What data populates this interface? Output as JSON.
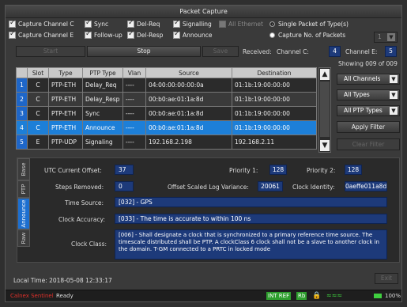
{
  "window": {
    "title": "Packet Capture"
  },
  "options": {
    "row1": [
      {
        "label": "Capture Channel C",
        "checked": true
      },
      {
        "label": "Sync",
        "checked": true
      },
      {
        "label": "Del-Req",
        "checked": true
      },
      {
        "label": "Signalling",
        "checked": true
      },
      {
        "label": "All Ethernet",
        "checked": false
      }
    ],
    "row2": [
      {
        "label": "Capture Channel E",
        "checked": true
      },
      {
        "label": "Follow-up",
        "checked": true
      },
      {
        "label": "Del-Resp",
        "checked": true
      },
      {
        "label": "Announce",
        "checked": true
      }
    ],
    "radio_single": "Single Packet of Type(s)",
    "radio_count": "Capture No. of Packets",
    "packet_count": "1"
  },
  "controls": {
    "start": "Start",
    "stop": "Stop",
    "save": "Save",
    "received_label": "Received:",
    "channel_c_label": "Channel C:",
    "channel_c_value": "4",
    "channel_e_label": "Channel E:",
    "channel_e_value": "5"
  },
  "table": {
    "headers": [
      "Slot",
      "Type",
      "PTP Type",
      "Vlan",
      "Source",
      "Destination"
    ],
    "rows": [
      {
        "idx": "1",
        "slot": "C",
        "type": "PTP-ETH",
        "ptp": "Delay_Req",
        "vlan": "----",
        "src": "04:00:00:00:00:0a",
        "dst": "01:1b:19:00:00:00"
      },
      {
        "idx": "2",
        "slot": "C",
        "type": "PTP-ETH",
        "ptp": "Delay_Resp",
        "vlan": "----",
        "src": "00:b0:ae:01:1a:8d",
        "dst": "01:1b:19:00:00:00"
      },
      {
        "idx": "3",
        "slot": "C",
        "type": "PTP-ETH",
        "ptp": "Sync",
        "vlan": "----",
        "src": "00:b0:ae:01:1a:8d",
        "dst": "01:1b:19:00:00:00"
      },
      {
        "idx": "4",
        "slot": "C",
        "type": "PTP-ETH",
        "ptp": "Announce",
        "vlan": "----",
        "src": "00:b0:ae:01:1a:8d",
        "dst": "01:1b:19:00:00:00"
      },
      {
        "idx": "5",
        "slot": "E",
        "type": "PTP-UDP",
        "ptp": "Signaling",
        "vlan": "----",
        "src": "192.168.2.198",
        "dst": "192.168.2.11"
      }
    ]
  },
  "filters": {
    "showing": "Showing 009 of 009",
    "channels": "All Channels",
    "types": "All Types",
    "ptp_types": "All PTP Types",
    "apply": "Apply Filter",
    "clear": "Clear Filter"
  },
  "tabs": [
    "Base",
    "PTP",
    "Announce",
    "Raw"
  ],
  "detail": {
    "utc_label": "UTC Current Offset:",
    "utc_value": "37",
    "p1_label": "Priority 1:",
    "p1_value": "128",
    "p2_label": "Priority 2:",
    "p2_value": "128",
    "steps_label": "Steps Removed:",
    "steps_value": "0",
    "oslv_label": "Offset Scaled Log Variance:",
    "oslv_value": "20061",
    "clockid_label": "Clock Identity:",
    "clockid_value": "0aeffe011a8d",
    "timesrc_label": "Time Source:",
    "timesrc_value": "[032] - GPS",
    "accuracy_label": "Clock Accuracy:",
    "accuracy_value": "[033] - The time is accurate to within 100 ns",
    "class_label": "Clock Class:",
    "class_value": "[006] - Shall designate a clock that is synchronized to a primary reference time source. The timescale distributed shall be PTP. A clockClass 6 clock shall not be a slave to another clock in the domain. T-GM connected to a PRTC in locked mode"
  },
  "footer": {
    "local_time_label": "Local Time:",
    "local_time_value": "2018-05-08 12:33:17",
    "exit": "Exit"
  },
  "status": {
    "app": "Calnex Sentinel",
    "state": "Ready",
    "intref": "INT REF",
    "rb": "Rb",
    "battery": "100%"
  }
}
